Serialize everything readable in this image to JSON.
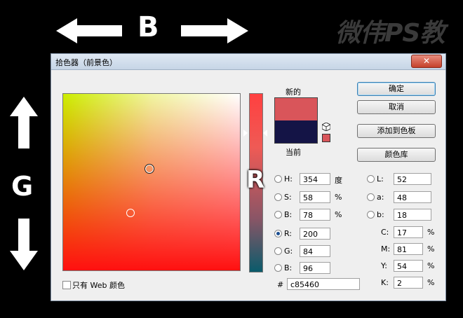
{
  "overlay": {
    "b_label": "B",
    "g_label": "G",
    "r_label": "R",
    "watermark": "微伟PS教"
  },
  "dialog": {
    "title": "拾色器（前景色）",
    "close_symbol": "✕",
    "new_label": "新的",
    "current_label": "当前",
    "colors": {
      "new": "#d9555a",
      "current": "#141446"
    },
    "buttons": {
      "ok": "确定",
      "cancel": "取消",
      "add_swatch": "添加到色板",
      "libraries": "颜色库"
    },
    "hsb": [
      {
        "label": "H:",
        "value": "354",
        "unit": "度",
        "selected": false
      },
      {
        "label": "S:",
        "value": "58",
        "unit": "%",
        "selected": false
      },
      {
        "label": "B:",
        "value": "78",
        "unit": "%",
        "selected": false
      }
    ],
    "rgb": [
      {
        "label": "R:",
        "value": "200",
        "selected": true
      },
      {
        "label": "G:",
        "value": "84",
        "selected": false
      },
      {
        "label": "B:",
        "value": "96",
        "selected": false
      }
    ],
    "lab": [
      {
        "label": "L:",
        "value": "52"
      },
      {
        "label": "a:",
        "value": "48"
      },
      {
        "label": "b:",
        "value": "18"
      }
    ],
    "cmyk": [
      {
        "label": "C:",
        "value": "17",
        "unit": "%"
      },
      {
        "label": "M:",
        "value": "81",
        "unit": "%"
      },
      {
        "label": "Y:",
        "value": "54",
        "unit": "%"
      },
      {
        "label": "K:",
        "value": "2",
        "unit": "%"
      }
    ],
    "hex_label": "#",
    "hex_value": "c85460",
    "web_only_label": "只有 Web 颜色"
  }
}
